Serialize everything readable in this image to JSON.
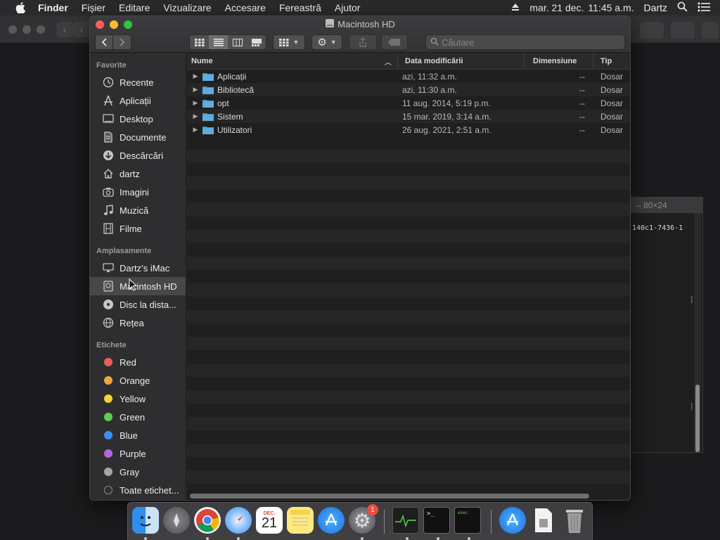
{
  "menubar": {
    "app_name": "Finder",
    "items": [
      "Fișier",
      "Editare",
      "Vizualizare",
      "Accesare",
      "Fereastră",
      "Ajutor"
    ],
    "date": "mar. 21 dec.",
    "time": "11:45 a.m.",
    "user": "Dartz"
  },
  "finder": {
    "title": "Macintosh HD",
    "search_placeholder": "Căutare",
    "sidebar": {
      "favorites_title": "Favorite",
      "favorites": [
        {
          "label": "Recente",
          "icon": "clock-icon"
        },
        {
          "label": "Aplicații",
          "icon": "applications-icon"
        },
        {
          "label": "Desktop",
          "icon": "desktop-icon"
        },
        {
          "label": "Documente",
          "icon": "document-icon"
        },
        {
          "label": "Descărcări",
          "icon": "download-icon"
        },
        {
          "label": "dartz",
          "icon": "home-icon"
        },
        {
          "label": "Imagini",
          "icon": "camera-icon"
        },
        {
          "label": "Muzică",
          "icon": "music-icon"
        },
        {
          "label": "Filme",
          "icon": "film-icon"
        }
      ],
      "locations_title": "Amplasamente",
      "locations": [
        {
          "label": "Dartz’s iMac",
          "icon": "imac-icon"
        },
        {
          "label": "Macintosh HD",
          "icon": "hard-drive-icon",
          "selected": true
        },
        {
          "label": "Disc la dista...",
          "icon": "disc-icon"
        },
        {
          "label": "Rețea",
          "icon": "network-icon"
        }
      ],
      "tags_title": "Etichete",
      "tags": [
        {
          "label": "Red",
          "color": "#ec5f5d"
        },
        {
          "label": "Orange",
          "color": "#f5a53a"
        },
        {
          "label": "Yellow",
          "color": "#f6d237"
        },
        {
          "label": "Green",
          "color": "#5bcf55"
        },
        {
          "label": "Blue",
          "color": "#3b8ff5"
        },
        {
          "label": "Purple",
          "color": "#b665e0"
        },
        {
          "label": "Gray",
          "color": "#a5a5a8"
        },
        {
          "label": "Toate etichet...",
          "color": "none"
        }
      ]
    },
    "columns": {
      "name": "Nume",
      "modified": "Data modificării",
      "size": "Dimensiune",
      "kind": "Tip"
    },
    "files": [
      {
        "name": "Aplicații",
        "modified": "azi, 11:32 a.m.",
        "size": "--",
        "kind": "Dosar"
      },
      {
        "name": "Bibliotecă",
        "modified": "azi, 11:30 a.m.",
        "size": "--",
        "kind": "Dosar"
      },
      {
        "name": "opt",
        "modified": "11 aug. 2014, 5:19 p.m.",
        "size": "--",
        "kind": "Dosar"
      },
      {
        "name": "Sistem",
        "modified": "15 mar. 2019, 3:14 a.m.",
        "size": "--",
        "kind": "Dosar"
      },
      {
        "name": "Utilizatori",
        "modified": "26 aug. 2021, 2:51 a.m.",
        "size": "--",
        "kind": "Dosar"
      }
    ]
  },
  "terminal": {
    "title": "– 80×24",
    "line": "140c1-7436-1"
  },
  "dock": {
    "calendar_month": "DEC.",
    "calendar_day": "21",
    "settings_badge": "1"
  }
}
